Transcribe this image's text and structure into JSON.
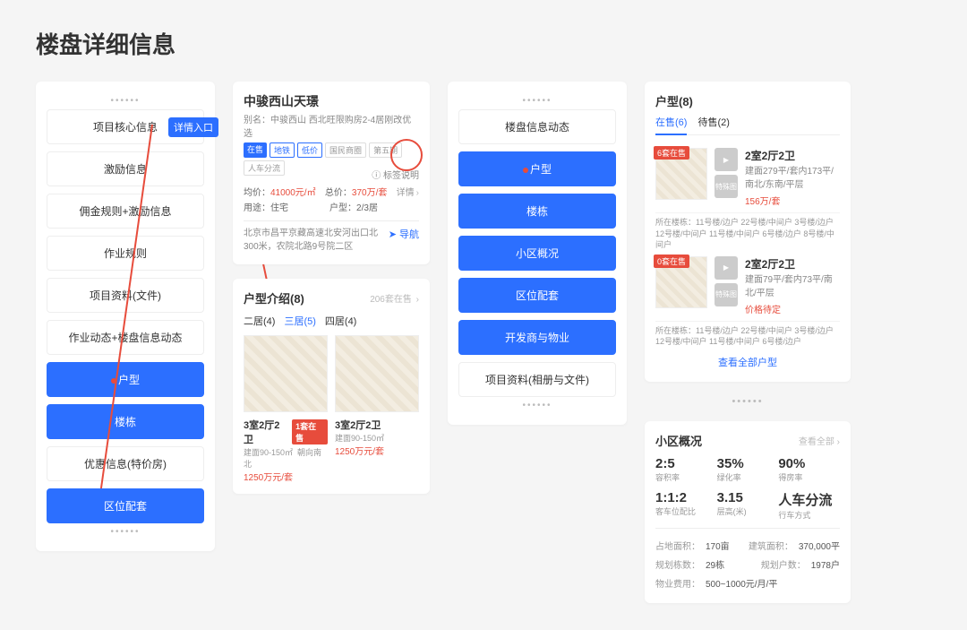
{
  "title": "楼盘详细信息",
  "entryBadge": "详情入口",
  "menu1": {
    "items": [
      {
        "label": "项目核心信息",
        "blue": false
      },
      {
        "label": "激励信息",
        "blue": false
      },
      {
        "label": "佣金规则+激励信息",
        "blue": false
      },
      {
        "label": "作业规则",
        "blue": false
      },
      {
        "label": "项目资料(文件)",
        "blue": false
      },
      {
        "label": "作业动态+楼盘信息动态",
        "blue": false
      },
      {
        "label": "户型",
        "blue": true,
        "dot": true
      },
      {
        "label": "楼栋",
        "blue": true
      },
      {
        "label": "优惠信息(特价房)",
        "blue": false
      },
      {
        "label": "区位配套",
        "blue": true
      }
    ]
  },
  "property": {
    "name": "中骏西山天璟",
    "alias": "别名：中骏西山 西北旺限购房2-4居刚改优选",
    "tags": [
      "在售",
      "地铁",
      "低价",
      "国民商圈",
      "第五期",
      "人车分流"
    ],
    "labelHint": "标签说明",
    "avgLabel": "均价：",
    "avg": "41000元/㎡",
    "totalLabel": "总价：",
    "total": "370万/套",
    "useLabel": "用途：",
    "use": "住宅",
    "layoutLabel": "户型：",
    "layout": "2/3居",
    "detail": "详情",
    "address": "北京市昌平京藏高速北安河出口北300米，农院北路9号院二区",
    "nav": "导航"
  },
  "floorplans": {
    "title": "户型介绍(8)",
    "count": "206套在售",
    "tabs": [
      "二居(4)",
      "三居(5)",
      "四居(4)"
    ],
    "activeTab": 1,
    "items": [
      {
        "title": "3室2厅2卫",
        "badge": "1套在售",
        "area": "建面90-150㎡",
        "orient": "朝向南北",
        "price": "1250万元/套"
      },
      {
        "title": "3室2厅2卫",
        "area": "建面90-150㎡",
        "price": "1250万元/套"
      }
    ]
  },
  "menu2": {
    "title": "楼盘信息动态",
    "items": [
      {
        "label": "户型",
        "blue": true,
        "dot": true
      },
      {
        "label": "楼栋",
        "blue": true
      },
      {
        "label": "小区概况",
        "blue": true
      },
      {
        "label": "区位配套",
        "blue": true
      },
      {
        "label": "开发商与物业",
        "blue": true
      }
    ],
    "footer": "项目资料(相册与文件)"
  },
  "huxing": {
    "title": "户型(8)",
    "tabs": [
      {
        "label": "在售(6)",
        "active": true
      },
      {
        "label": "待售(2)",
        "active": false
      }
    ],
    "units": [
      {
        "badge": "6套在售",
        "title": "2室2厅2卫",
        "desc": "建面279平/套内173平/南北/东南/平层",
        "price": "156万/套",
        "loc": "所在楼栋：11号楼/边户  22号楼/中间户  3号楼/边户  12号楼/中间户  11号楼/中间户  6号楼/边户  8号楼/中间户"
      },
      {
        "badge": "0套在售",
        "title": "2室2厅2卫",
        "desc": "建面79平/套内73平/南北/平层",
        "price": "价格待定",
        "loc": "所在楼栋：11号楼/边户  22号楼/中间户  3号楼/边户  12号楼/中间户  11号楼/中间户  6号楼/边户"
      }
    ],
    "viewAll": "查看全部户型"
  },
  "community": {
    "title": "小区概况",
    "more": "查看全部",
    "row1": [
      {
        "big": "2:5",
        "lbl": "容积率"
      },
      {
        "big": "35%",
        "lbl": "绿化率"
      },
      {
        "big": "90%",
        "lbl": "得房率"
      }
    ],
    "row2": [
      {
        "big": "1:1:2",
        "lbl": "客车位配比"
      },
      {
        "big": "3.15",
        "lbl": "层高(米)"
      },
      {
        "big": "人车分流",
        "lbl": "行车方式"
      }
    ],
    "info": [
      {
        "l": "占地面积：",
        "v": "170亩",
        "l2": "建筑面积：",
        "v2": "370,000平"
      },
      {
        "l": "规划栋数：",
        "v": "29栋",
        "l2": "规划户数：",
        "v2": "1978户"
      },
      {
        "l": "物业费用：",
        "v": "500~1000元/月/平"
      }
    ]
  }
}
